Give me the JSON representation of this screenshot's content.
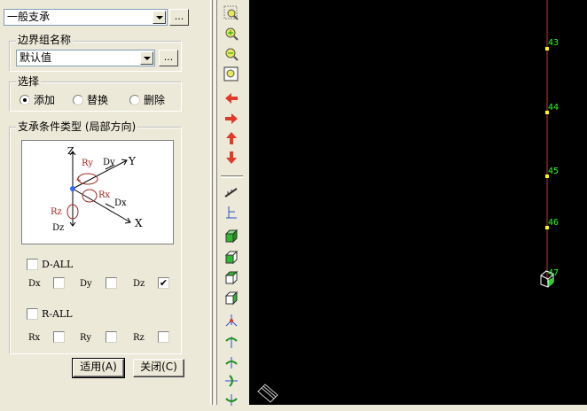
{
  "panel": {
    "type_combo": {
      "value": "一般支承",
      "button": "..."
    },
    "group_name": {
      "label": "边界组名称",
      "value": "默认值",
      "button": "..."
    },
    "select": {
      "label": "选择",
      "options": [
        "添加",
        "替换",
        "删除"
      ],
      "selected": "添加"
    },
    "support": {
      "label": "支承条件类型 (局部方向)",
      "diagram": {
        "axis_labels": {
          "z": "Z",
          "y": "Y",
          "x": "X",
          "ry": "Ry",
          "dy": "Dy",
          "rx": "Rx",
          "dx": "Dx",
          "rz": "Rz",
          "dz": "Dz"
        }
      },
      "d_all": {
        "label": "D-ALL",
        "checked": false
      },
      "d_items": [
        {
          "label": "Dx",
          "checked": false
        },
        {
          "label": "Dy",
          "checked": false
        },
        {
          "label": "Dz",
          "checked": true
        }
      ],
      "r_all": {
        "label": "R-ALL",
        "checked": false
      },
      "r_items": [
        {
          "label": "Rx",
          "checked": false
        },
        {
          "label": "Ry",
          "checked": false
        },
        {
          "label": "Rz",
          "checked": false
        }
      ]
    },
    "buttons": {
      "apply": "适用(A)",
      "close": "关闭(C)"
    }
  },
  "toolbar": {
    "icons": [
      "zoom-window-icon",
      "zoom-in-icon",
      "zoom-out-icon",
      "zoom-fit-icon",
      "pan-left-icon",
      "pan-right-icon",
      "pan-up-icon",
      "pan-down-icon",
      "angle-icon",
      "dimension-icon",
      "view-iso-icon",
      "view-front-icon",
      "view-top-icon",
      "view-side-icon",
      "node-icon",
      "rotate-icon",
      "rotate-y-icon",
      "rotate-z-icon",
      "rotate-x-icon"
    ]
  },
  "canvas": {
    "background": "#000000",
    "member_color": "#c0392b",
    "node_color": "#ffff00",
    "label_color": "#22ff22",
    "nodes": [
      "43",
      "44",
      "45",
      "46",
      "47"
    ]
  }
}
